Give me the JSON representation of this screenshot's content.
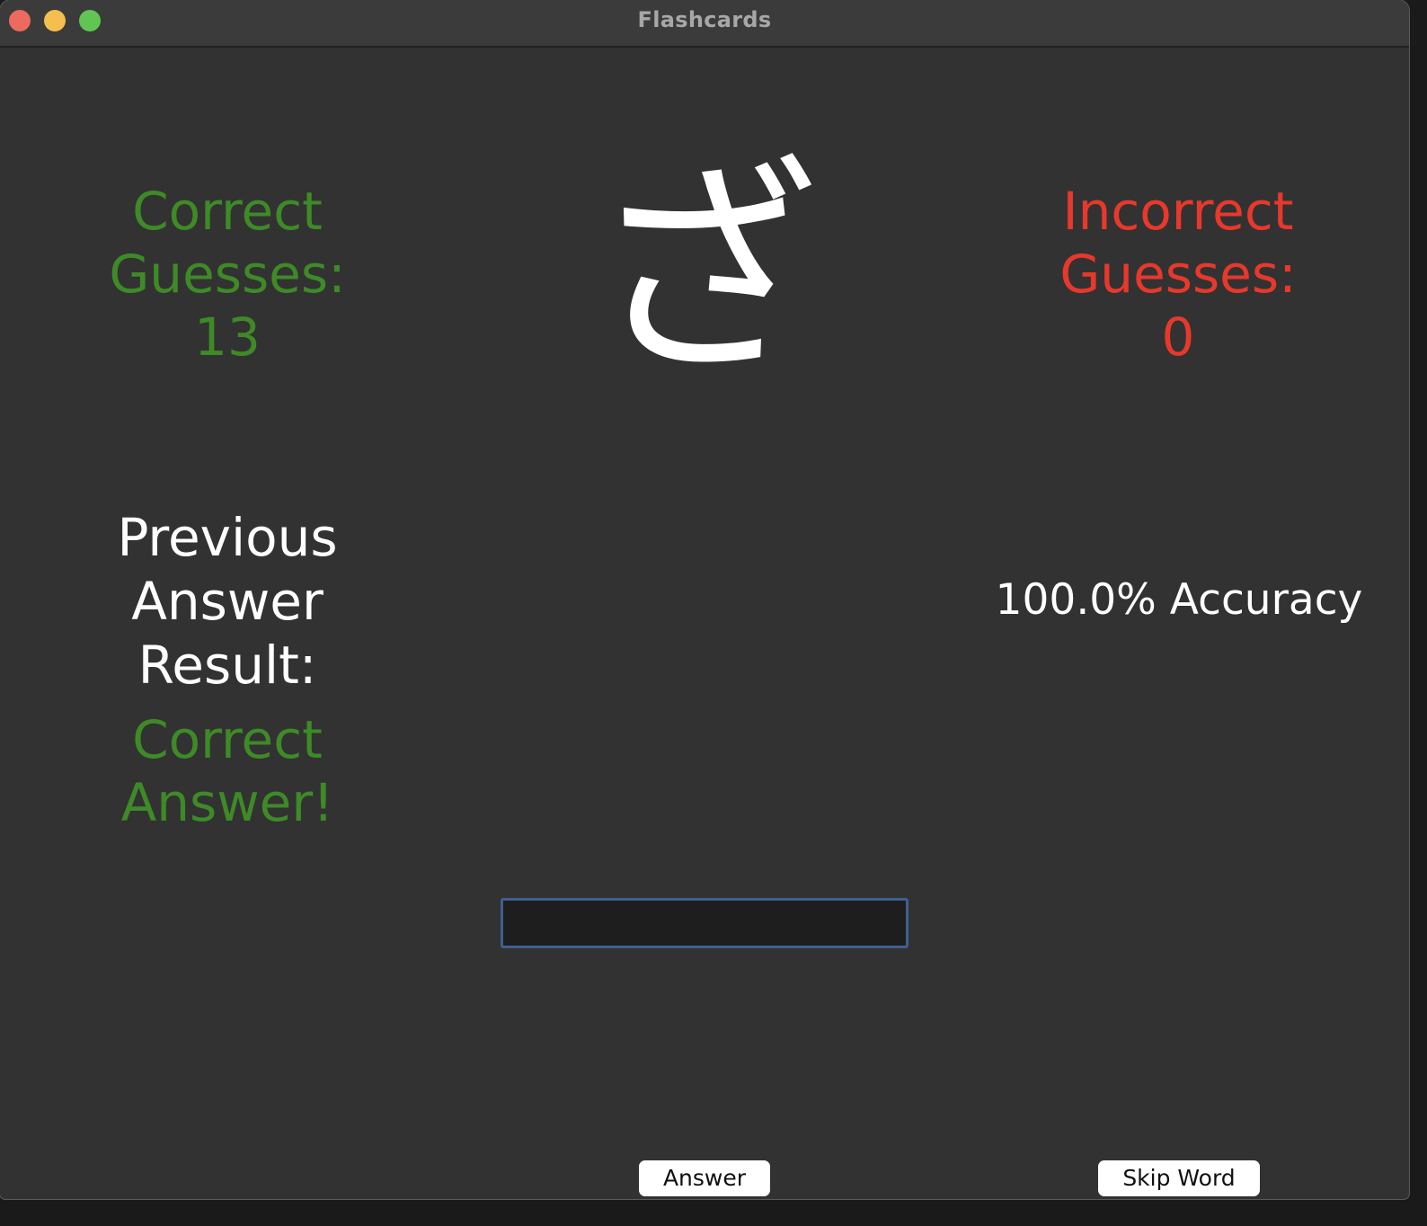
{
  "window": {
    "title": "Flashcards"
  },
  "correct": {
    "line1": "Correct",
    "line2": "Guesses:",
    "count": "13"
  },
  "incorrect": {
    "line1": "Incorrect",
    "line2": "Guesses:",
    "count": "0"
  },
  "card": {
    "kana": "ざ"
  },
  "previous": {
    "line1": "Previous",
    "line2": "Answer",
    "line3": "Result:",
    "result": "Correct Answer!"
  },
  "accuracy": {
    "text": "100.0% Accuracy"
  },
  "input": {
    "value": "",
    "placeholder": ""
  },
  "buttons": {
    "answer": "Answer",
    "skip": "Skip Word"
  },
  "colors": {
    "correct": "#3e8a27",
    "incorrect": "#e8382c",
    "background": "#323232",
    "text": "#ffffff"
  }
}
